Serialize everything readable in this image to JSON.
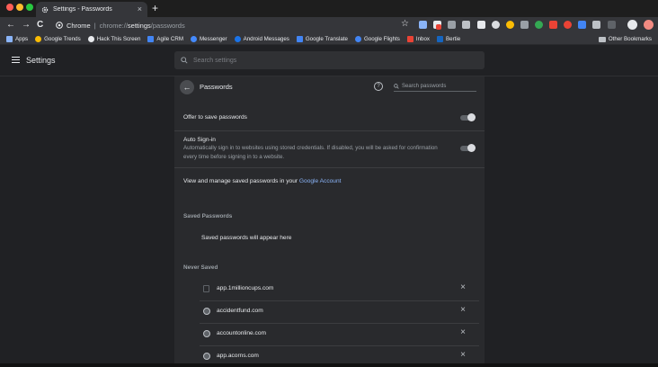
{
  "window": {
    "tab_title": "Settings - Passwords",
    "tab_close": "×",
    "new_tab": "+"
  },
  "toolbar": {
    "back": "←",
    "forward": "→",
    "reload": "C",
    "omnibox_host": "Chrome",
    "omnibox_sep": "|",
    "omnibox_scheme": "chrome://",
    "omnibox_path_bold": "settings",
    "omnibox_path_rest": "/passwords"
  },
  "bookmarks": {
    "items": [
      {
        "label": "Apps",
        "icon": "apps-grid-icon",
        "color": "#8ab4f8"
      },
      {
        "label": "Google Trends",
        "icon": "trends-icon",
        "color": "#fbbc04"
      },
      {
        "label": "Hack This Screen",
        "icon": "hack-icon",
        "color": "#e8eaed"
      },
      {
        "label": "Agile CRM",
        "icon": "agile-crm-icon",
        "color": "#4285f4"
      },
      {
        "label": "Messenger",
        "icon": "messenger-icon",
        "color": "#448aff"
      },
      {
        "label": "Android Messages",
        "icon": "android-messages-icon",
        "color": "#1a73e8"
      },
      {
        "label": "Google Translate",
        "icon": "translate-icon",
        "color": "#4285f4"
      },
      {
        "label": "Google Flights",
        "icon": "flights-icon",
        "color": "#4285f4"
      },
      {
        "label": "Inbox",
        "icon": "inbox-icon",
        "color": "#ea4335"
      },
      {
        "label": "Bertie",
        "icon": "bertie-icon",
        "color": "#1565c0"
      }
    ],
    "other": "Other Bookmarks"
  },
  "settings": {
    "title": "Settings",
    "search_placeholder": "Search settings"
  },
  "passwords": {
    "title": "Passwords",
    "search_placeholder": "Search passwords",
    "offer_to_save": "Offer to save passwords",
    "auto_signin_title": "Auto Sign-in",
    "auto_signin_desc": "Automatically sign in to websites using stored credentials. If disabled, you will be asked for confirmation every time before signing in to a website.",
    "manage_prefix": "View and manage saved passwords in your ",
    "manage_link": "Google Account",
    "saved_label": "Saved Passwords",
    "saved_empty": "Saved passwords will appear here",
    "never_saved_label": "Never Saved",
    "never_saved": [
      {
        "site": "app.1millioncups.com",
        "icon": "blank-page-icon"
      },
      {
        "site": "accidentfund.com",
        "icon": "globe-icon"
      },
      {
        "site": "accountonline.com",
        "icon": "globe-icon"
      },
      {
        "site": "app.acorns.com",
        "icon": "globe-icon"
      }
    ],
    "remove_glyph": "×"
  }
}
